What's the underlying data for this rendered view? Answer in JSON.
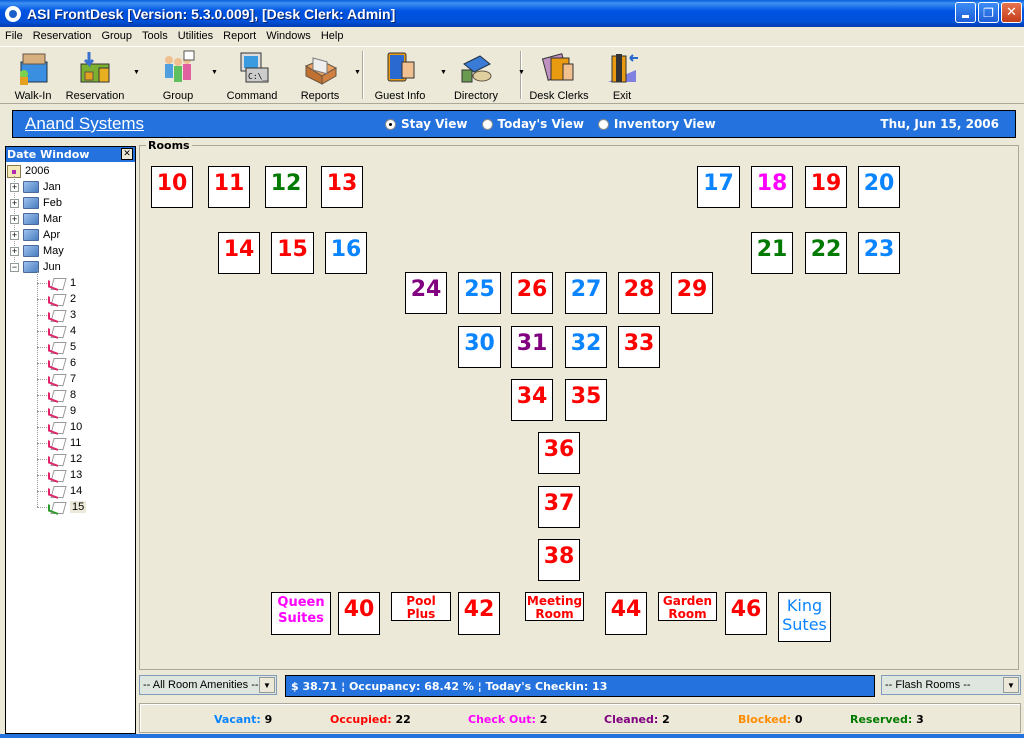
{
  "window": {
    "title": "ASI FrontDesk [Version: 5.3.0.009], [Desk Clerk: Admin]",
    "buttons": [
      "minimize",
      "restore",
      "close"
    ]
  },
  "menu": [
    "File",
    "Reservation",
    "Group",
    "Tools",
    "Utilities",
    "Report",
    "Windows",
    "Help"
  ],
  "toolbar": [
    {
      "label": "Walk-In",
      "icon": "walk-in-icon",
      "dropdown": false
    },
    {
      "label": "Reservation",
      "icon": "reservation-icon",
      "dropdown": true
    },
    {
      "label": "Group",
      "icon": "group-icon",
      "dropdown": true
    },
    {
      "label": "Command",
      "icon": "command-icon",
      "dropdown": false
    },
    {
      "label": "Reports",
      "icon": "reports-icon",
      "dropdown": true
    },
    {
      "label": "Guest Info",
      "icon": "guest-info-icon",
      "dropdown": true
    },
    {
      "label": "Directory",
      "icon": "directory-icon",
      "dropdown": true
    },
    {
      "label": "Desk Clerks",
      "icon": "desk-clerks-icon",
      "dropdown": false
    },
    {
      "label": "Exit",
      "icon": "exit-icon",
      "dropdown": false
    }
  ],
  "banner": {
    "company": "Anand Systems",
    "views": [
      {
        "label": "Stay View",
        "selected": true
      },
      {
        "label": "Today's View",
        "selected": false
      },
      {
        "label": "Inventory View",
        "selected": false
      }
    ],
    "date": "Thu, Jun 15, 2006"
  },
  "date_window": {
    "title": "Date Window",
    "year": "2006",
    "months": [
      {
        "label": "Jan",
        "expanded": false
      },
      {
        "label": "Feb",
        "expanded": false
      },
      {
        "label": "Mar",
        "expanded": false
      },
      {
        "label": "Apr",
        "expanded": false
      },
      {
        "label": "May",
        "expanded": false
      },
      {
        "label": "Jun",
        "expanded": true
      }
    ],
    "days": [
      "1",
      "2",
      "3",
      "4",
      "5",
      "6",
      "7",
      "8",
      "9",
      "10",
      "11",
      "12",
      "13",
      "14",
      "15"
    ],
    "selected_day": "15"
  },
  "rooms_label": "Rooms",
  "status_colors": {
    "vacant": "#0A84FF",
    "occupied": "#FF0000",
    "checkout": "#FF00FF",
    "cleaned": "#800080",
    "blocked": "#FF8C00",
    "reserved": "#007A00"
  },
  "rooms": [
    {
      "label": "10",
      "status": "occupied"
    },
    {
      "label": "11",
      "status": "occupied"
    },
    {
      "label": "12",
      "status": "reserved"
    },
    {
      "label": "13",
      "status": "occupied"
    },
    {
      "label": "17",
      "status": "vacant"
    },
    {
      "label": "18",
      "status": "checkout"
    },
    {
      "label": "19",
      "status": "occupied"
    },
    {
      "label": "20",
      "status": "vacant"
    },
    {
      "label": "14",
      "status": "occupied"
    },
    {
      "label": "15",
      "status": "occupied"
    },
    {
      "label": "16",
      "status": "vacant"
    },
    {
      "label": "21",
      "status": "reserved"
    },
    {
      "label": "22",
      "status": "reserved"
    },
    {
      "label": "23",
      "status": "vacant"
    },
    {
      "label": "24",
      "status": "cleaned"
    },
    {
      "label": "25",
      "status": "vacant"
    },
    {
      "label": "26",
      "status": "occupied"
    },
    {
      "label": "27",
      "status": "vacant"
    },
    {
      "label": "28",
      "status": "occupied"
    },
    {
      "label": "29",
      "status": "occupied"
    },
    {
      "label": "30",
      "status": "vacant"
    },
    {
      "label": "31",
      "status": "cleaned"
    },
    {
      "label": "32",
      "status": "vacant"
    },
    {
      "label": "33",
      "status": "occupied"
    },
    {
      "label": "34",
      "status": "occupied"
    },
    {
      "label": "35",
      "status": "occupied"
    },
    {
      "label": "36",
      "status": "occupied"
    },
    {
      "label": "37",
      "status": "occupied"
    },
    {
      "label": "38",
      "status": "occupied"
    },
    {
      "label": "Queen Suites",
      "status": "checkout"
    },
    {
      "label": "40",
      "status": "occupied"
    },
    {
      "label": "Pool Plus",
      "status": "occupied"
    },
    {
      "label": "42",
      "status": "occupied"
    },
    {
      "label": "Meeting Room",
      "status": "occupied"
    },
    {
      "label": "44",
      "status": "occupied"
    },
    {
      "label": "Garden Room",
      "status": "occupied"
    },
    {
      "label": "46",
      "status": "occupied"
    },
    {
      "label": "King Sutes",
      "status": "vacant"
    }
  ],
  "amenities_select": "-- All Room Amenities --",
  "info_bar": "$ 38.71 ¦ Occupancy: 68.42 % ¦ Today's Checkin: 13",
  "flash_select": "-- Flash Rooms --",
  "summary": [
    {
      "label": "Vacant:",
      "value": "9",
      "status": "vacant"
    },
    {
      "label": "Occupied:",
      "value": "22",
      "status": "occupied"
    },
    {
      "label": "Check Out:",
      "value": "2",
      "status": "checkout"
    },
    {
      "label": "Cleaned:",
      "value": "2",
      "status": "cleaned"
    },
    {
      "label": "Blocked:",
      "value": "0",
      "status": "blocked"
    },
    {
      "label": "Reserved:",
      "value": "3",
      "status": "reserved"
    }
  ]
}
